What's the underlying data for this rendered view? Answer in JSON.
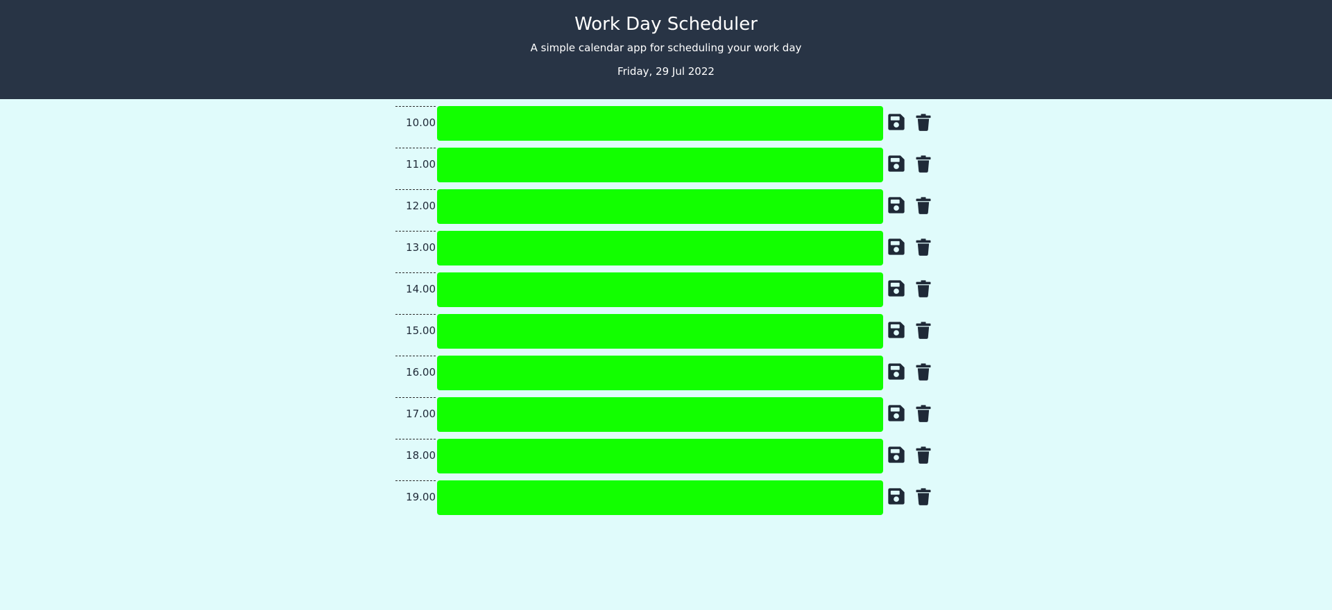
{
  "header": {
    "title": "Work Day Scheduler",
    "subtitle": "A simple calendar app for scheduling your work day",
    "date": "Friday, 29 Jul 2022"
  },
  "colors": {
    "header_bg": "#283445",
    "page_bg": "#e0fbfb",
    "future_slot": "#12ff00",
    "icon": "#1f2937"
  },
  "schedule": [
    {
      "hour": "10.00",
      "task": ""
    },
    {
      "hour": "11.00",
      "task": ""
    },
    {
      "hour": "12.00",
      "task": ""
    },
    {
      "hour": "13.00",
      "task": ""
    },
    {
      "hour": "14.00",
      "task": ""
    },
    {
      "hour": "15.00",
      "task": ""
    },
    {
      "hour": "16.00",
      "task": ""
    },
    {
      "hour": "17.00",
      "task": ""
    },
    {
      "hour": "18.00",
      "task": ""
    },
    {
      "hour": "19.00",
      "task": ""
    }
  ],
  "icons": {
    "save": "floppy-disk-icon",
    "delete": "trash-icon"
  }
}
